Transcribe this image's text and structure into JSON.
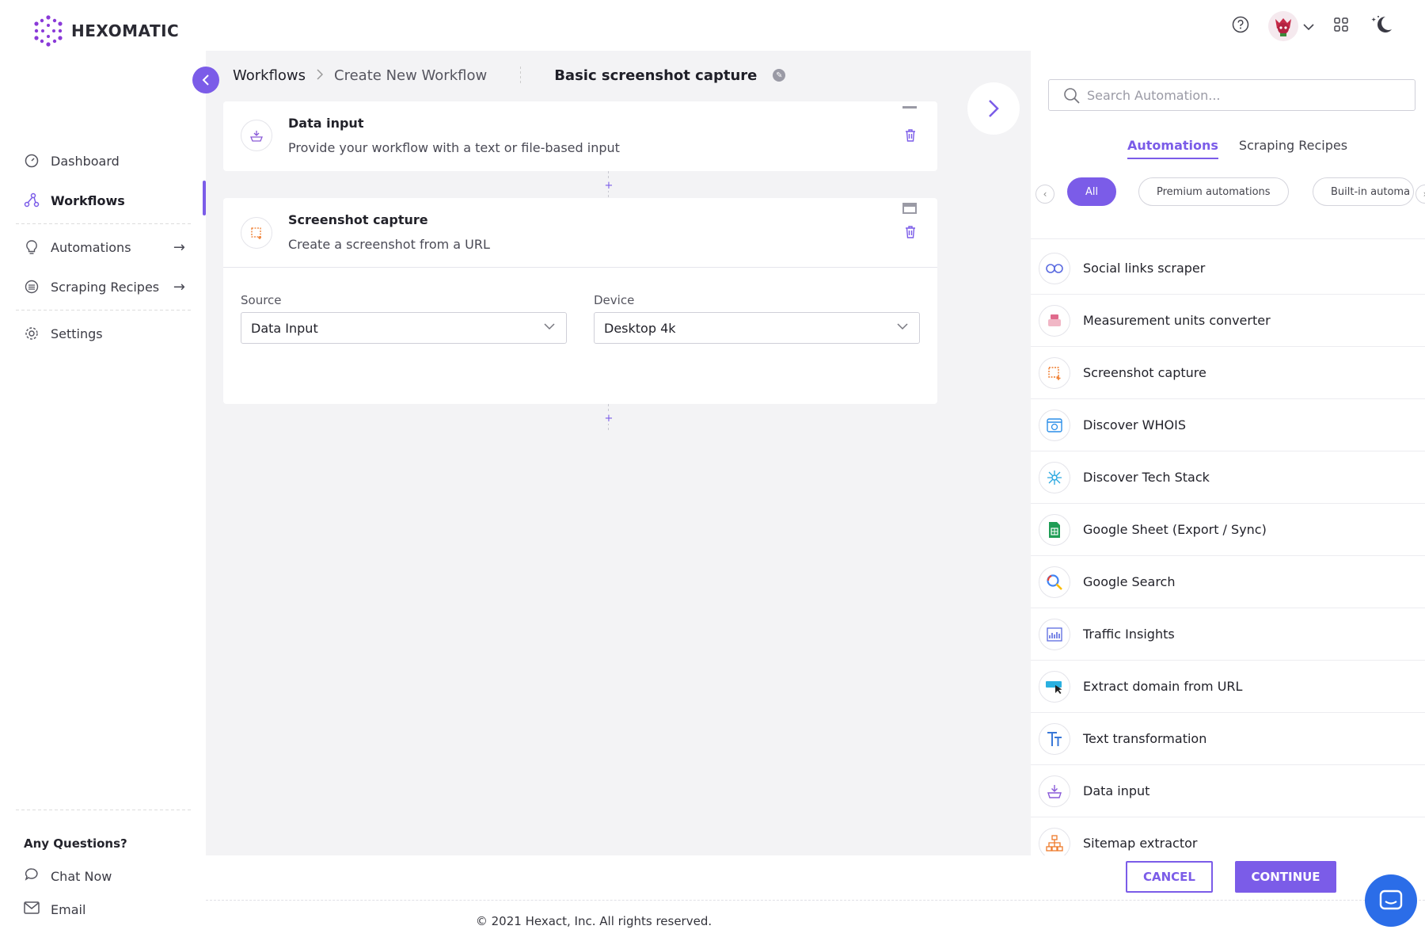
{
  "brand": {
    "name": "HEXOMATIC",
    "accent": "#7b5ce8"
  },
  "sidebar": {
    "items": [
      {
        "label": "Dashboard",
        "icon": "dashboard-icon"
      },
      {
        "label": "Workflows",
        "icon": "workflow-icon",
        "active": true
      },
      {
        "label": "Automations",
        "icon": "bulb-icon",
        "arrow": "→"
      },
      {
        "label": "Scraping Recipes",
        "icon": "recipes-icon",
        "arrow": "→"
      },
      {
        "label": "Settings",
        "icon": "gear-icon"
      }
    ],
    "questions_title": "Any Questions?",
    "chat_label": "Chat Now",
    "email_label": "Email"
  },
  "breadcrumb": {
    "root": "Workflows",
    "current": "Create New Workflow",
    "workflow_name": "Basic screenshot capture"
  },
  "cards": [
    {
      "title": "Data input",
      "description": "Provide your workflow with a text or file-based input"
    },
    {
      "title": "Screenshot capture",
      "description": "Create a screenshot from a URL"
    }
  ],
  "form": {
    "source_label": "Source",
    "source_value": "Data Input",
    "device_label": "Device",
    "device_value": "Desktop 4k"
  },
  "panel": {
    "search_placeholder": "Search Automation...",
    "tabs": [
      "Automations",
      "Scraping Recipes"
    ],
    "chips": [
      "All",
      "Premium automations",
      "Built-in automa"
    ],
    "automations": [
      "Social links scraper",
      "Measurement units converter",
      "Screenshot capture",
      "Discover WHOIS",
      "Discover Tech Stack",
      "Google Sheet (Export / Sync)",
      "Google Search",
      "Traffic Insights",
      "Extract domain from URL",
      "Text transformation",
      "Data input",
      "Sitemap extractor"
    ]
  },
  "footer": {
    "cancel": "CANCEL",
    "continue": "CONTINUE",
    "copyright": "© 2021 Hexact, Inc. All rights reserved."
  }
}
